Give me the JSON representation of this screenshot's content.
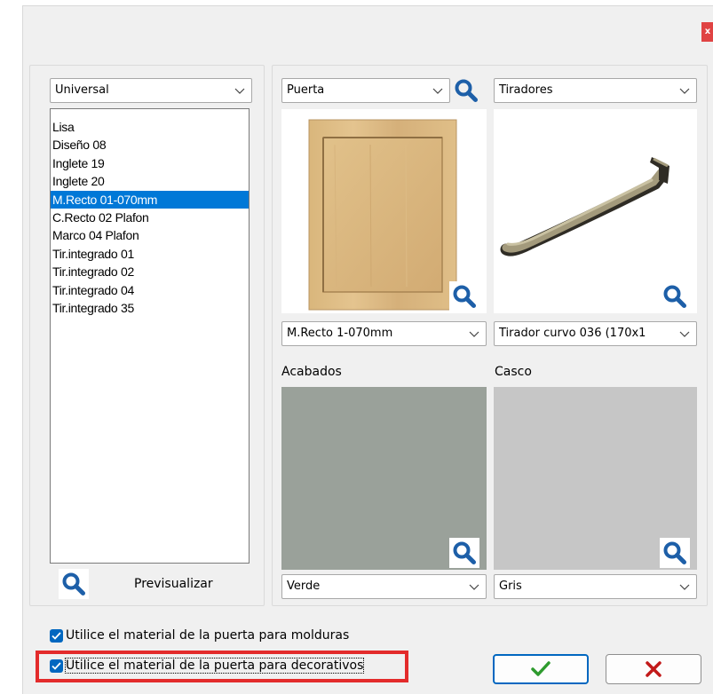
{
  "window": {
    "close_label": "x"
  },
  "left_panel": {
    "category_combo": "Universal",
    "items": [
      "Lisa",
      "Diseño 08",
      "Inglete 19",
      "Inglete 20",
      "M.Recto 01-070mm",
      "C.Recto 02 Plafon",
      "Marco 04 Plafon",
      "Tir.integrado 01",
      "Tir.integrado 02",
      "Tir.integrado 04",
      "Tir.integrado 35"
    ],
    "selected_item": "M.Recto 01-070mm",
    "preview_label": "Previsualizar"
  },
  "door": {
    "type_combo": "Puerta",
    "model_combo": "M.Recto 1-070mm"
  },
  "handles": {
    "type_combo": "Tiradores",
    "model_combo": "Tirador curvo 036 (170x1"
  },
  "finishes": {
    "label": "Acabados",
    "color_hex": "#9aa19a",
    "value": "Verde"
  },
  "carcass": {
    "label": "Casco",
    "color_hex": "#c6c6c6",
    "value": "Gris"
  },
  "options": {
    "mouldings_label": "Utilice el material de la puerta para molduras",
    "mouldings_checked": true,
    "decoratives_label": "Utilice el material de la puerta para decorativos",
    "decoratives_checked": true
  },
  "colors": {
    "accent": "#0067c0",
    "selection": "#0078d7",
    "ok_check": "#2e9b2e",
    "cancel_x": "#c21a1a",
    "highlight": "#e32b2b"
  },
  "icons": {
    "search": "magnifier-icon",
    "ok": "checkmark-icon",
    "cancel": "x-icon"
  }
}
